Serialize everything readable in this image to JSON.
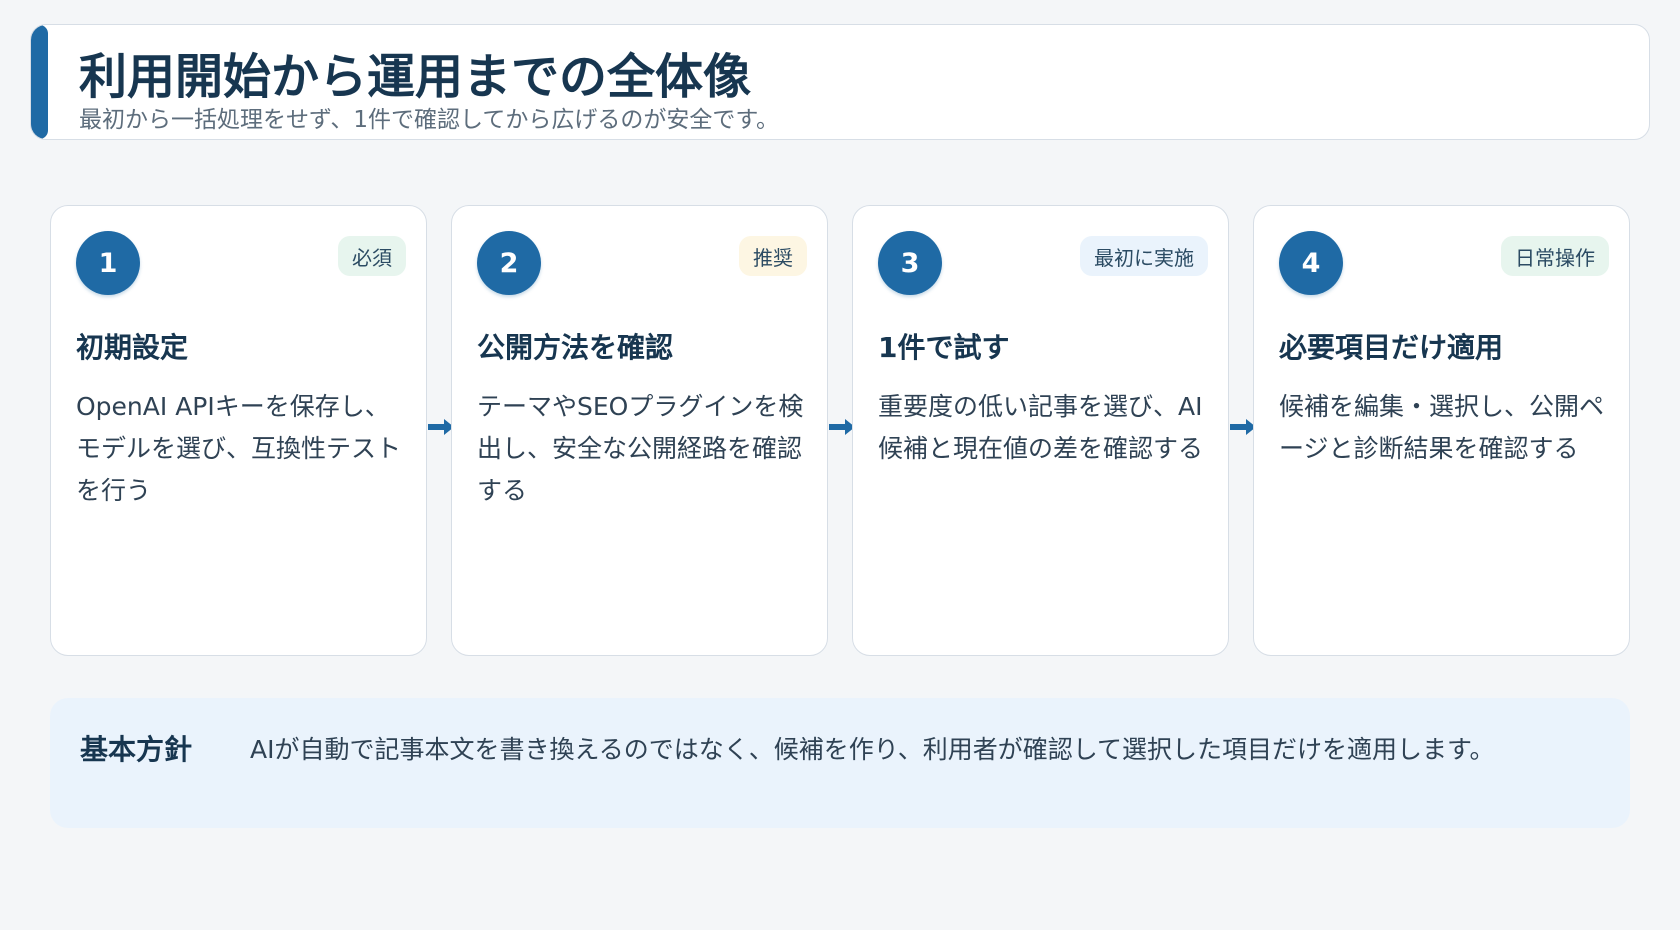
{
  "header": {
    "title": "利用開始から運用までの全体像",
    "subtitle": "最初から一括処理をせず、1件で確認してから広げるのが安全です。"
  },
  "colors": {
    "accent": "#1f6aa5",
    "badge_green_bg": "#e7f5ee",
    "badge_yellow_bg": "#fdf6e3",
    "badge_blue_bg": "#eaf3fc"
  },
  "steps": [
    {
      "number": "1",
      "badge": "必須",
      "badge_color": "#e7f5ee",
      "title": "初期設定",
      "description": "OpenAI APIキーを保存し、モデルを選び、互換性テストを行う"
    },
    {
      "number": "2",
      "badge": "推奨",
      "badge_color": "#fdf6e3",
      "title": "公開方法を確認",
      "description": "テーマやSEOプラグインを検出し、安全な公開経路を確認する"
    },
    {
      "number": "3",
      "badge": "最初に実施",
      "badge_color": "#eaf3fc",
      "title": "1件で試す",
      "description": "重要度の低い記事を選び、AI候補と現在値の差を確認する"
    },
    {
      "number": "4",
      "badge": "日常操作",
      "badge_color": "#e7f5ee",
      "title": "必要項目だけ適用",
      "description": "候補を編集・選択し、公開ページと診断結果を確認する"
    }
  ],
  "policy": {
    "label": "基本方針",
    "text": "AIが自動で記事本文を書き換えるのではなく、候補を作り、利用者が確認して選択した項目だけを適用します。"
  }
}
